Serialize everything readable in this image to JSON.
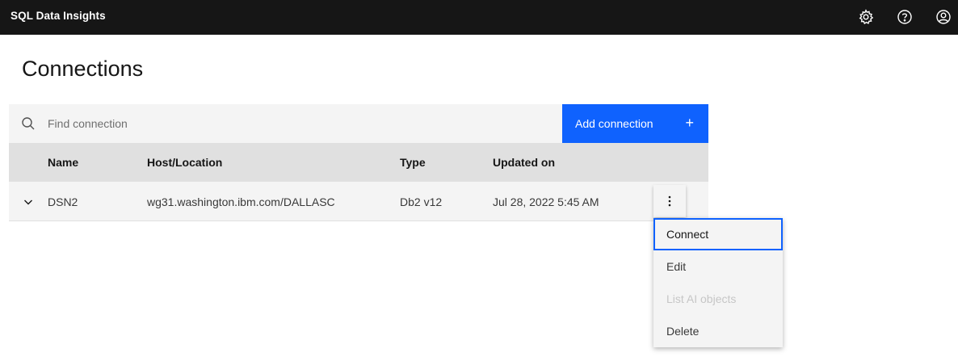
{
  "app": {
    "title": "SQL Data Insights"
  },
  "header_icons": [
    "gear-icon",
    "help-icon",
    "user-avatar-icon"
  ],
  "page": {
    "title": "Connections"
  },
  "search": {
    "placeholder": "Find connection",
    "value": ""
  },
  "add_button": {
    "label": "Add connection",
    "icon": "+"
  },
  "table": {
    "columns": [
      "Name",
      "Host/Location",
      "Type",
      "Updated on"
    ],
    "rows": [
      {
        "name": "DSN2",
        "host": "wg31.washington.ibm.com/DALLASC",
        "type": "Db2 v12",
        "updated": "Jul 28, 2022 5:45 AM"
      }
    ]
  },
  "overflow_menu": {
    "items": [
      {
        "label": "Connect",
        "state": "focused"
      },
      {
        "label": "Edit",
        "state": "enabled"
      },
      {
        "label": "List AI objects",
        "state": "disabled"
      },
      {
        "label": "Delete",
        "state": "enabled"
      }
    ]
  },
  "colors": {
    "topbar": "#161616",
    "primary": "#0f62fe",
    "header_row": "#e0e0e0",
    "surface": "#f4f4f4"
  }
}
